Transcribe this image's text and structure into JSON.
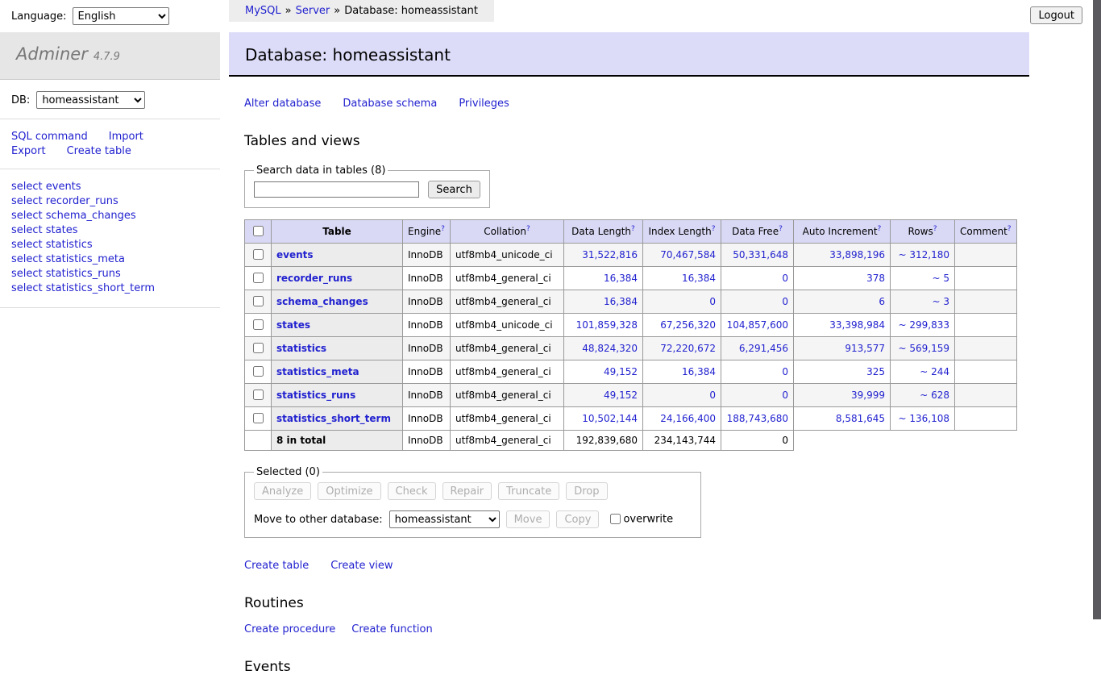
{
  "topbar": {
    "language_label": "Language:",
    "language_value": "English",
    "breadcrumb": [
      "MySQL",
      "Server",
      "Database: homeassistant"
    ],
    "breadcrumb_separator": "»",
    "logout_label": "Logout"
  },
  "sidebar": {
    "logo_title": "Adminer",
    "logo_version": "4.7.9",
    "db_label": "DB:",
    "db_value": "homeassistant",
    "actions": [
      "SQL command",
      "Import",
      "Export",
      "Create table"
    ],
    "table_links": [
      "select events",
      "select recorder_runs",
      "select schema_changes",
      "select states",
      "select statistics",
      "select statistics_meta",
      "select statistics_runs",
      "select statistics_short_term"
    ]
  },
  "main": {
    "title": "Database: homeassistant",
    "links": [
      "Alter database",
      "Database schema",
      "Privileges"
    ],
    "tables_heading": "Tables and views",
    "search": {
      "legend": "Search data in tables (8)",
      "value": "",
      "button": "Search"
    },
    "table": {
      "help_mark": "?",
      "columns": {
        "table": "Table",
        "engine": "Engine",
        "collation": "Collation",
        "data_length": "Data Length",
        "index_length": "Index Length",
        "data_free": "Data Free",
        "auto_increment": "Auto Increment",
        "rows": "Rows",
        "comment": "Comment"
      },
      "rows": [
        {
          "name": "events",
          "engine": "InnoDB",
          "collation": "utf8mb4_unicode_ci",
          "data_length": "31,522,816",
          "index_length": "70,467,584",
          "data_free": "50,331,648",
          "auto_increment": "33,898,196",
          "rows": "~ 312,180",
          "comment": ""
        },
        {
          "name": "recorder_runs",
          "engine": "InnoDB",
          "collation": "utf8mb4_general_ci",
          "data_length": "16,384",
          "index_length": "16,384",
          "data_free": "0",
          "auto_increment": "378",
          "rows": "~ 5",
          "comment": ""
        },
        {
          "name": "schema_changes",
          "engine": "InnoDB",
          "collation": "utf8mb4_general_ci",
          "data_length": "16,384",
          "index_length": "0",
          "data_free": "0",
          "auto_increment": "6",
          "rows": "~ 3",
          "comment": ""
        },
        {
          "name": "states",
          "engine": "InnoDB",
          "collation": "utf8mb4_unicode_ci",
          "data_length": "101,859,328",
          "index_length": "67,256,320",
          "data_free": "104,857,600",
          "auto_increment": "33,398,984",
          "rows": "~ 299,833",
          "comment": ""
        },
        {
          "name": "statistics",
          "engine": "InnoDB",
          "collation": "utf8mb4_general_ci",
          "data_length": "48,824,320",
          "index_length": "72,220,672",
          "data_free": "6,291,456",
          "auto_increment": "913,577",
          "rows": "~ 569,159",
          "comment": ""
        },
        {
          "name": "statistics_meta",
          "engine": "InnoDB",
          "collation": "utf8mb4_general_ci",
          "data_length": "49,152",
          "index_length": "16,384",
          "data_free": "0",
          "auto_increment": "325",
          "rows": "~ 244",
          "comment": ""
        },
        {
          "name": "statistics_runs",
          "engine": "InnoDB",
          "collation": "utf8mb4_general_ci",
          "data_length": "49,152",
          "index_length": "0",
          "data_free": "0",
          "auto_increment": "39,999",
          "rows": "~ 628",
          "comment": ""
        },
        {
          "name": "statistics_short_term",
          "engine": "InnoDB",
          "collation": "utf8mb4_general_ci",
          "data_length": "10,502,144",
          "index_length": "24,166,400",
          "data_free": "188,743,680",
          "auto_increment": "8,581,645",
          "rows": "~ 136,108",
          "comment": ""
        }
      ],
      "total": {
        "name": "8 in total",
        "engine": "InnoDB",
        "collation": "utf8mb4_general_ci",
        "data_length": "192,839,680",
        "index_length": "234,143,744",
        "data_free": "0"
      }
    },
    "selected": {
      "legend": "Selected (0)",
      "buttons": [
        "Analyze",
        "Optimize",
        "Check",
        "Repair",
        "Truncate",
        "Drop"
      ],
      "move_label": "Move to other database:",
      "move_db_value": "homeassistant",
      "move_button": "Move",
      "copy_button": "Copy",
      "overwrite_label": "overwrite"
    },
    "create_links": [
      "Create table",
      "Create view"
    ],
    "routines_heading": "Routines",
    "routine_links": [
      "Create procedure",
      "Create function"
    ],
    "events_heading": "Events"
  },
  "colors": {
    "link": "#2222d0",
    "title_bar_bg": "#dcdcf8",
    "table_head_bg": "#d9d9f6",
    "th_bg": "#ececec",
    "stripe_bg": "#f5f5f5",
    "table_border": "#999999",
    "logo_bg": "#e6e6e6",
    "breadcrumb_bg": "#ededed",
    "scrollbar": "#5a5a5e"
  }
}
